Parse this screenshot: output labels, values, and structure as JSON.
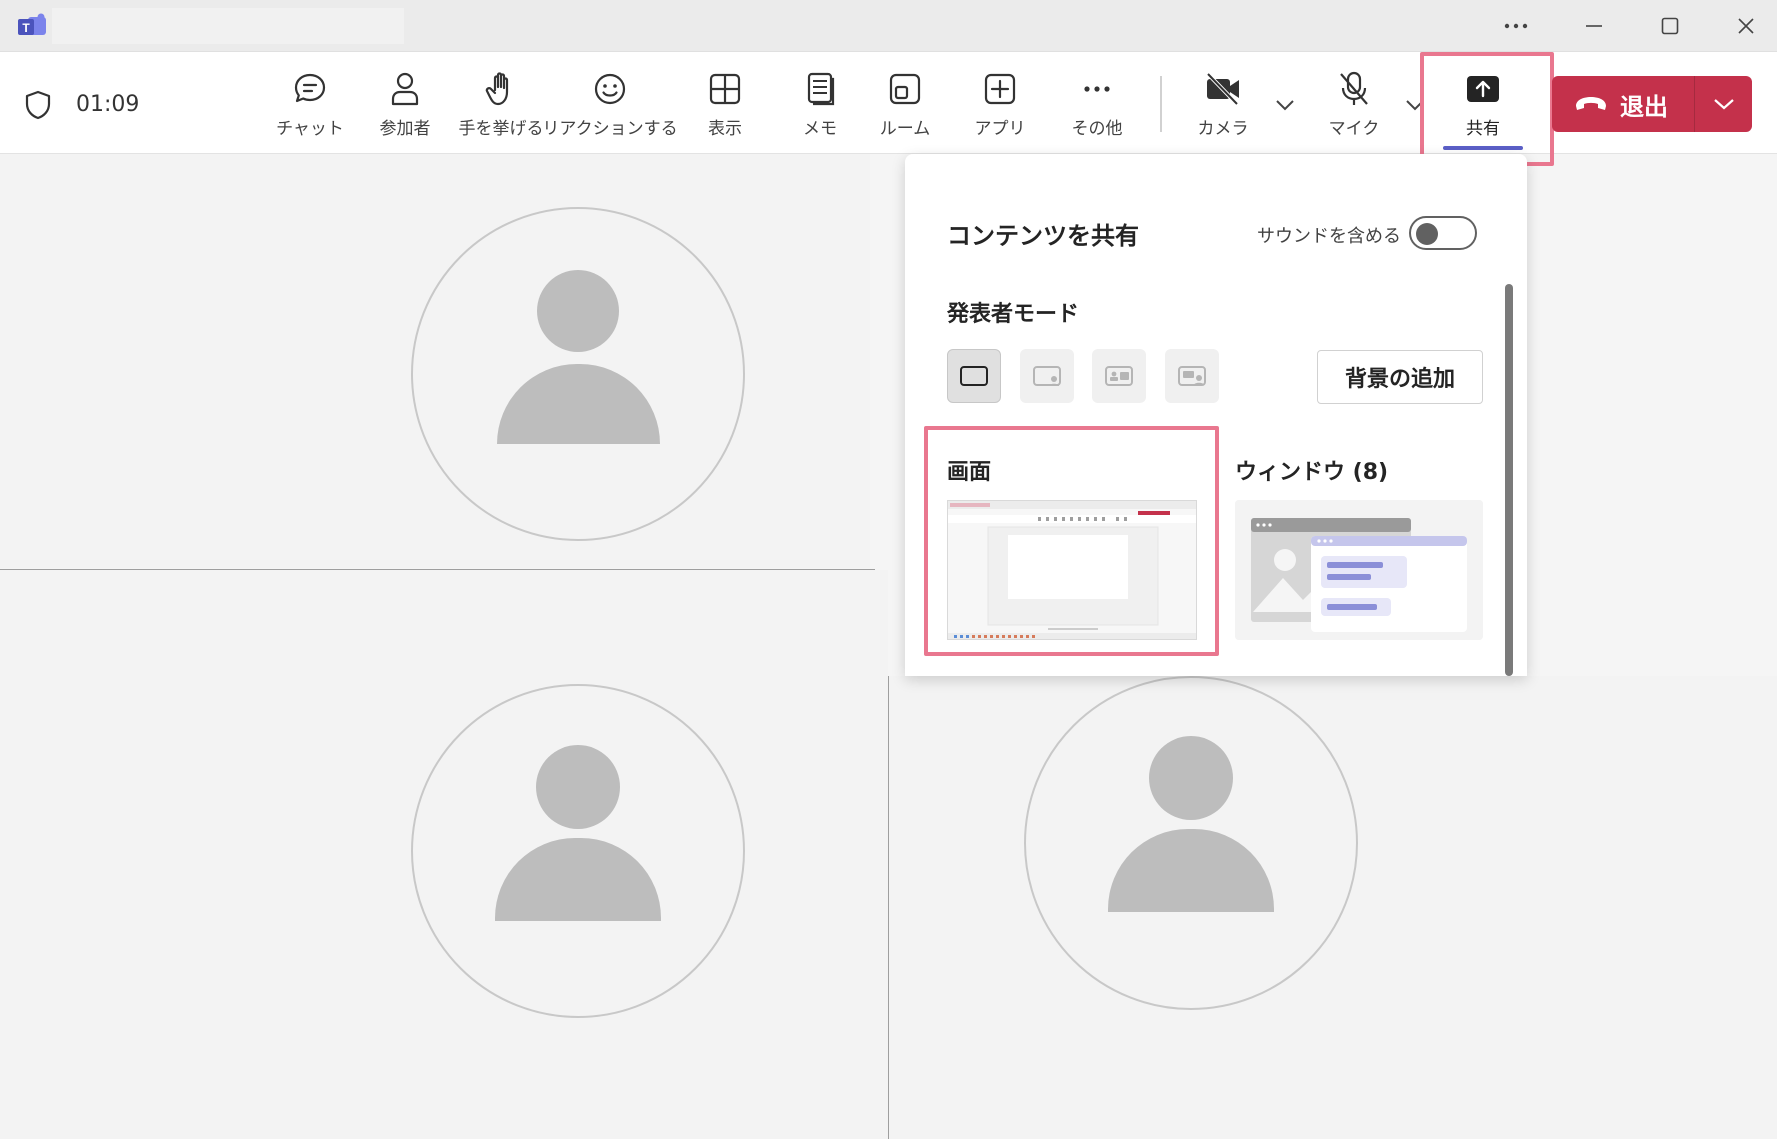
{
  "meeting": {
    "timer": "01:09"
  },
  "toolbar": {
    "items": [
      {
        "label": "チャット",
        "icon": "chat-icon"
      },
      {
        "label": "参加者",
        "icon": "people-icon"
      },
      {
        "label": "手を挙げる",
        "icon": "raise-hand-icon"
      },
      {
        "label": "リアクションする",
        "icon": "emoji-icon"
      },
      {
        "label": "表示",
        "icon": "grid-view-icon"
      },
      {
        "label": "メモ",
        "icon": "notes-icon"
      },
      {
        "label": "ルーム",
        "icon": "rooms-icon"
      },
      {
        "label": "アプリ",
        "icon": "add-app-icon"
      },
      {
        "label": "その他",
        "icon": "more-icon"
      },
      {
        "label": "カメラ",
        "icon": "camera-off-icon"
      },
      {
        "label": "マイク",
        "icon": "mic-off-icon"
      },
      {
        "label": "共有",
        "icon": "share-icon"
      }
    ],
    "leave_label": "退出",
    "leave_color": "#c4314b",
    "accent_color": "#5b5fc7"
  },
  "share_panel": {
    "title": "コンテンツを共有",
    "sound_label": "サウンドを含める",
    "sound_on": false,
    "presenter_mode_label": "発表者モード",
    "add_background_label": "背景の追加",
    "screen_label": "画面",
    "window_label": "ウィンドウ (8)"
  },
  "highlight_color": "#e9778f"
}
